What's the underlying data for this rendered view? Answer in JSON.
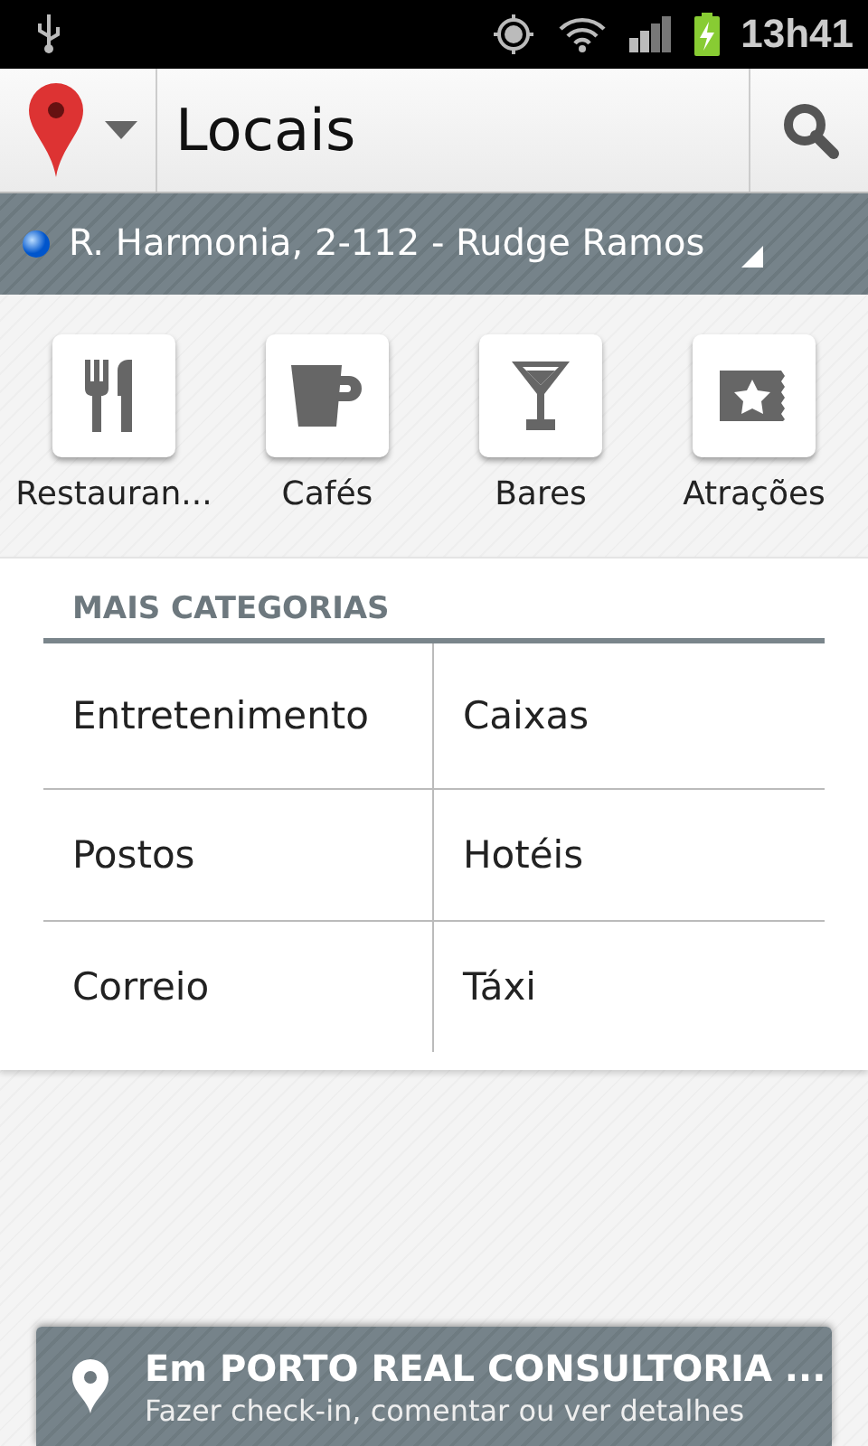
{
  "status_bar": {
    "time": "13h41"
  },
  "toolbar": {
    "title": "Locais"
  },
  "location": {
    "address": "R. Harmonia, 2-112 - Rudge Ramos"
  },
  "categories": [
    {
      "kind": "restaurant",
      "label": "Restauran..."
    },
    {
      "kind": "cafe",
      "label": "Cafés"
    },
    {
      "kind": "bar",
      "label": "Bares"
    },
    {
      "kind": "attraction",
      "label": "Atrações"
    }
  ],
  "more_categories": {
    "heading": "MAIS CATEGORIAS",
    "items": [
      "Entretenimento",
      "Caixas",
      "Postos",
      "Hotéis",
      "Correio",
      "Táxi"
    ]
  },
  "checkin": {
    "title": "Em PORTO REAL CONSULTORIA ...",
    "subtitle": "Fazer check-in, comentar ou ver detalhes"
  }
}
